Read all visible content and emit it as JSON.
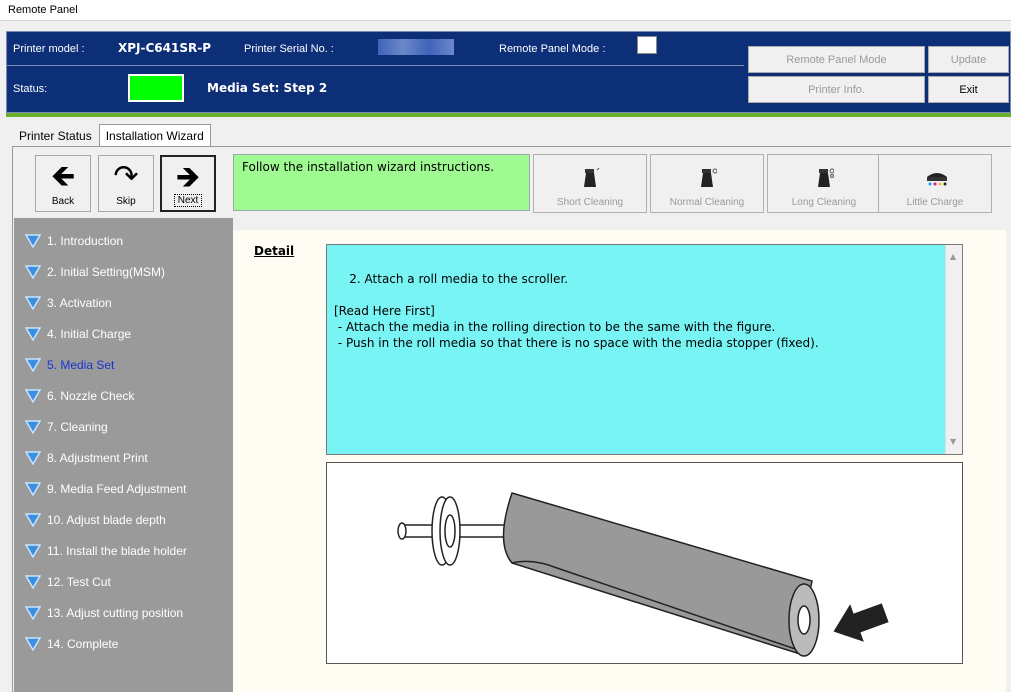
{
  "window": {
    "title": "Remote Panel"
  },
  "header": {
    "model_label": "Printer model :",
    "model_value": "XPJ-C641SR-P",
    "serial_label": "Printer Serial No. :",
    "mode_label": "Remote Panel Mode :",
    "status_label": "Status:",
    "status_text": "Media Set: Step 2",
    "status_color": "#00ff00",
    "buttons": {
      "remote_panel_mode": "Remote Panel Mode",
      "update": "Update",
      "printer_info": "Printer Info.",
      "exit": "Exit"
    }
  },
  "tabs": [
    "Printer Status",
    "Installation Wizard"
  ],
  "toolbar": {
    "back": "Back",
    "skip": "Skip",
    "next": "Next",
    "message": "Follow the installation wizard instructions.",
    "short_cleaning": "Short Cleaning",
    "normal_cleaning": "Normal Cleaning",
    "long_cleaning": "Long Cleaning",
    "little_charge": "Little Charge"
  },
  "steps": [
    "1. Introduction",
    "2. Initial Setting(MSM)",
    "3. Activation",
    "4. Initial Charge",
    "5. Media Set",
    "6. Nozzle Check",
    "7. Cleaning",
    "8. Adjustment Print",
    "9. Media Feed Adjustment",
    "10. Adjust blade depth",
    "11. Install the blade holder",
    "12. Test Cut",
    "13. Adjust cutting position",
    "14. Complete"
  ],
  "current_step": "5. Media Set",
  "detail": {
    "label": "Detail",
    "text": "2. Attach a roll media to the scroller.\n\n[Read Here First]\n - Attach the media in the rolling direction to be the same with the figure.\n - Push in the roll media so that there is no space with the media stopper (fixed)."
  }
}
